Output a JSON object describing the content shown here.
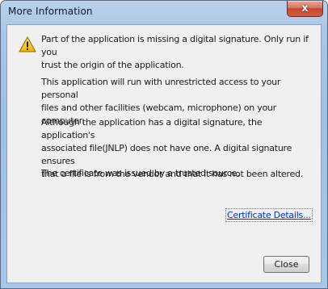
{
  "window": {
    "title": "More Information",
    "close_glyph": "x"
  },
  "message": {
    "icon": "warning-icon",
    "paragraphs": [
      "Part of the application is missing a digital signature. Only run if you\ntrust the origin of the application.",
      "This application will run with unrestricted access to your personal\nfiles and other facilities (webcam, microphone) on your computer.",
      "Although the application has a digital signature, the application's\nassociated file(JNLP) does not have one. A digital signature ensures\nthat a file is from the vendor and that it has not been altered.",
      "The certificate was issued by a trusted source."
    ]
  },
  "links": {
    "certificate_details": "Certificate Details..."
  },
  "buttons": {
    "close": "Close"
  },
  "colors": {
    "title_bar": "#a9c7e8",
    "client_bg": "#f0f0f0",
    "link": "#0033cc",
    "close_x": "#c24a2f",
    "warning_fill": "#f5c400"
  }
}
